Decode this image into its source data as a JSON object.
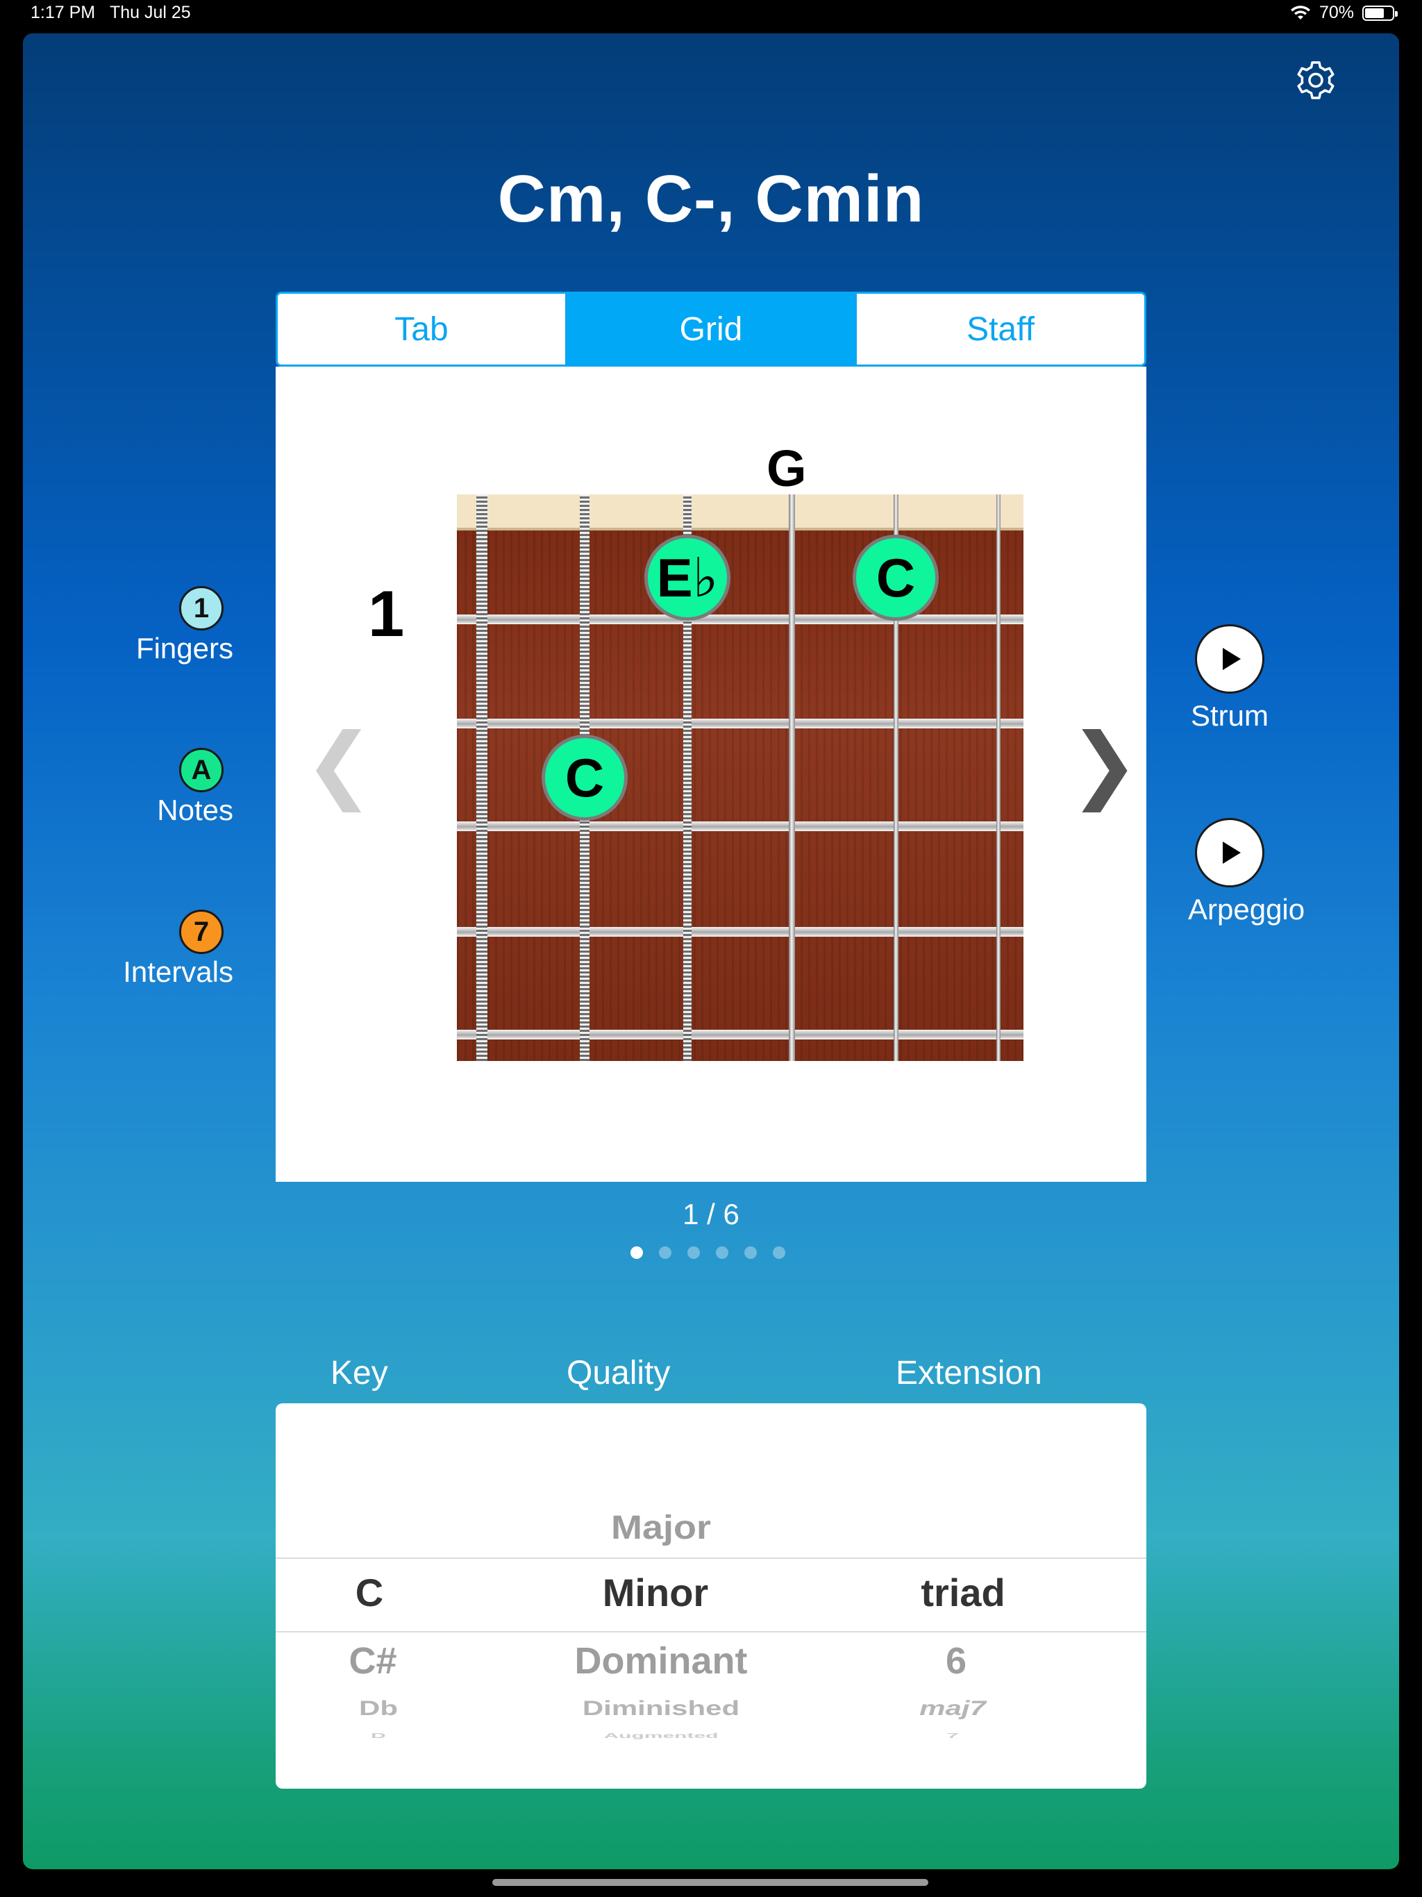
{
  "status_bar": {
    "time": "1:17 PM",
    "date": "Thu Jul 25",
    "battery": "70%",
    "battery_level": 0.7
  },
  "header": {
    "chord_title": "Cm, C-, Cmin",
    "settings_icon": "gear-icon"
  },
  "view_tabs": [
    {
      "label": "Tab",
      "active": false
    },
    {
      "label": "Grid",
      "active": true
    },
    {
      "label": "Staff",
      "active": false
    }
  ],
  "diagram": {
    "string_label": "G",
    "start_fret": "1",
    "notes": [
      {
        "label": "E♭",
        "string": 3,
        "fret": 1
      },
      {
        "label": "C",
        "string": 5,
        "fret": 1
      },
      {
        "label": "C",
        "string": 2,
        "fret": 3
      }
    ],
    "prev_arrow": "❮",
    "next_arrow": "❯"
  },
  "pager": {
    "text": "1 / 6",
    "current": 1,
    "total": 6
  },
  "display_options": [
    {
      "badge": "1",
      "label": "Fingers",
      "color": "#a6e8f0"
    },
    {
      "badge": "A",
      "label": "Notes",
      "color": "#15e68d"
    },
    {
      "badge": "7",
      "label": "Intervals",
      "color": "#f7931e"
    }
  ],
  "playback": [
    {
      "label": "Strum",
      "icon": "play-icon"
    },
    {
      "label": "Arpeggio",
      "icon": "play-icon"
    }
  ],
  "picker": {
    "headers": {
      "key": "Key",
      "quality": "Quality",
      "extension": "Extension"
    },
    "key": {
      "selected": "C",
      "below": [
        "C#",
        "Db",
        "D"
      ]
    },
    "quality": {
      "above": "Major",
      "selected": "Minor",
      "below": [
        "Dominant",
        "Diminished",
        "Augmented"
      ]
    },
    "extension": {
      "selected": "triad",
      "below": [
        "6",
        "maj7",
        "7"
      ]
    }
  }
}
